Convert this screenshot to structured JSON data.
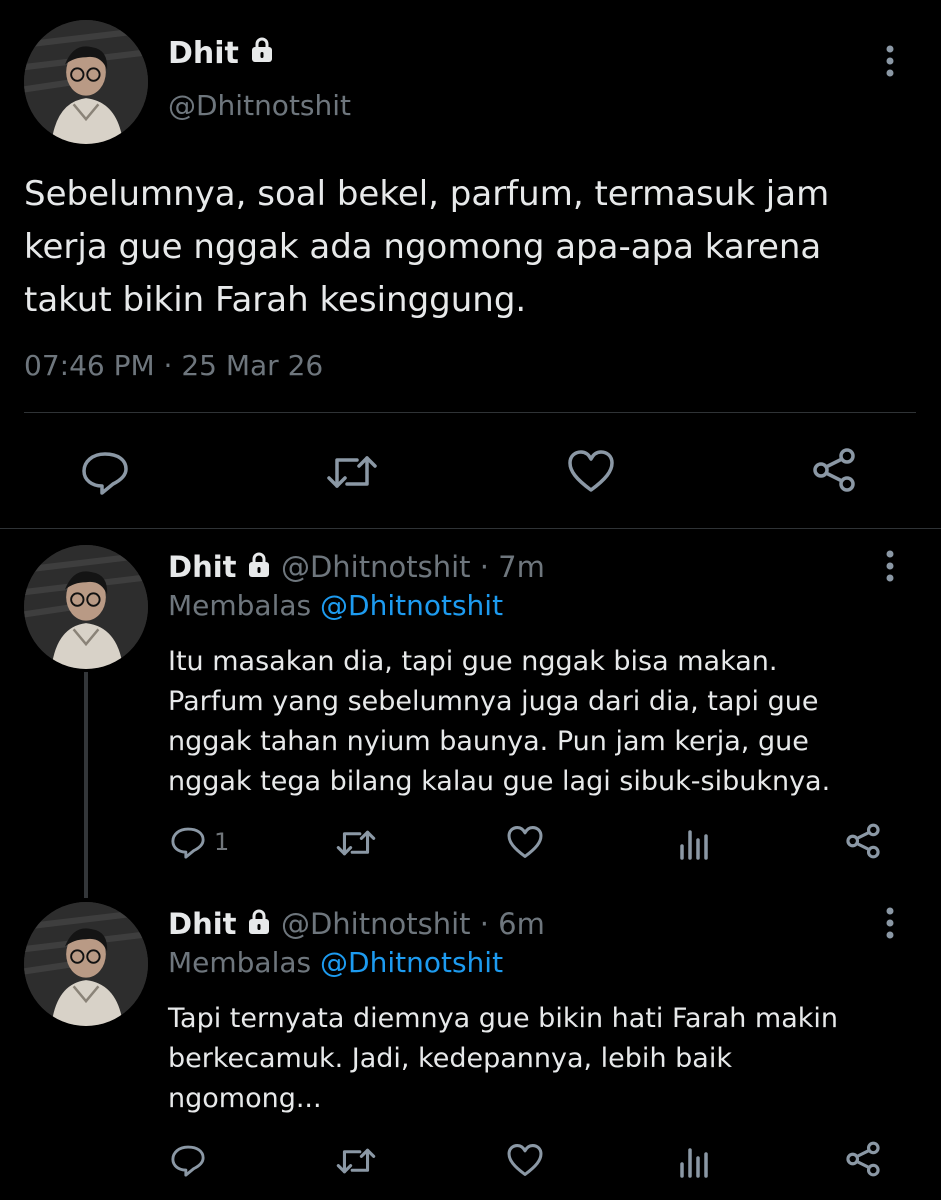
{
  "main_tweet": {
    "display_name": "Dhit",
    "handle": "@Dhitnotshit",
    "text_lines": [
      "Sebelumnya, soal bekel, parfum, termasuk jam",
      "kerja gue nggak ada ngomong apa-apa karena",
      "takut bikin Farah kesinggung."
    ],
    "timestamp": "07:46 PM · 25 Mar 26",
    "icons": [
      "more-vertical-icon",
      "reply-icon",
      "retweet-icon",
      "like-icon",
      "share-icon"
    ]
  },
  "replies": [
    {
      "display_name": "Dhit",
      "handle": "@Dhitnotshit",
      "time": "· 7m",
      "replying_prefix": "Membalas",
      "replying_to": "@Dhitnotshit",
      "text_lines": [
        "Itu masakan dia, tapi gue nggak bisa makan.",
        "Parfum yang sebelumnya juga dari dia, tapi gue",
        "nggak tahan nyium baunya. Pun jam kerja, gue",
        "nggak tega bilang kalau gue lagi sibuk-sibuknya."
      ],
      "reply_count": "1"
    },
    {
      "display_name": "Dhit",
      "handle": "@Dhitnotshit",
      "time": "· 6m",
      "replying_prefix": "Membalas",
      "replying_to": "@Dhitnotshit",
      "text_lines": [
        "Tapi ternyata diemnya gue bikin hati Farah makin",
        "berkecamuk. Jadi, kedepannya, lebih baik",
        "ngomong..."
      ],
      "reply_count": ""
    }
  ],
  "colors": {
    "background": "#000000",
    "text": "#E7E9EA",
    "muted": "#6E767D",
    "link": "#1D9BF0",
    "divider": "#2F3336"
  }
}
